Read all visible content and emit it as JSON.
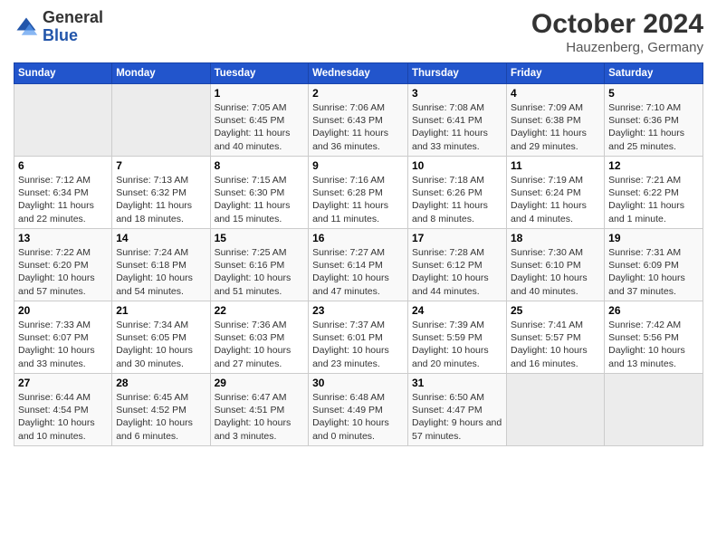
{
  "header": {
    "logo": {
      "general": "General",
      "blue": "Blue"
    },
    "title": "October 2024",
    "location": "Hauzenberg, Germany"
  },
  "calendar": {
    "weekdays": [
      "Sunday",
      "Monday",
      "Tuesday",
      "Wednesday",
      "Thursday",
      "Friday",
      "Saturday"
    ],
    "weeks": [
      [
        {
          "day": "",
          "info": ""
        },
        {
          "day": "",
          "info": ""
        },
        {
          "day": "1",
          "info": "Sunrise: 7:05 AM\nSunset: 6:45 PM\nDaylight: 11 hours and 40 minutes."
        },
        {
          "day": "2",
          "info": "Sunrise: 7:06 AM\nSunset: 6:43 PM\nDaylight: 11 hours and 36 minutes."
        },
        {
          "day": "3",
          "info": "Sunrise: 7:08 AM\nSunset: 6:41 PM\nDaylight: 11 hours and 33 minutes."
        },
        {
          "day": "4",
          "info": "Sunrise: 7:09 AM\nSunset: 6:38 PM\nDaylight: 11 hours and 29 minutes."
        },
        {
          "day": "5",
          "info": "Sunrise: 7:10 AM\nSunset: 6:36 PM\nDaylight: 11 hours and 25 minutes."
        }
      ],
      [
        {
          "day": "6",
          "info": "Sunrise: 7:12 AM\nSunset: 6:34 PM\nDaylight: 11 hours and 22 minutes."
        },
        {
          "day": "7",
          "info": "Sunrise: 7:13 AM\nSunset: 6:32 PM\nDaylight: 11 hours and 18 minutes."
        },
        {
          "day": "8",
          "info": "Sunrise: 7:15 AM\nSunset: 6:30 PM\nDaylight: 11 hours and 15 minutes."
        },
        {
          "day": "9",
          "info": "Sunrise: 7:16 AM\nSunset: 6:28 PM\nDaylight: 11 hours and 11 minutes."
        },
        {
          "day": "10",
          "info": "Sunrise: 7:18 AM\nSunset: 6:26 PM\nDaylight: 11 hours and 8 minutes."
        },
        {
          "day": "11",
          "info": "Sunrise: 7:19 AM\nSunset: 6:24 PM\nDaylight: 11 hours and 4 minutes."
        },
        {
          "day": "12",
          "info": "Sunrise: 7:21 AM\nSunset: 6:22 PM\nDaylight: 11 hours and 1 minute."
        }
      ],
      [
        {
          "day": "13",
          "info": "Sunrise: 7:22 AM\nSunset: 6:20 PM\nDaylight: 10 hours and 57 minutes."
        },
        {
          "day": "14",
          "info": "Sunrise: 7:24 AM\nSunset: 6:18 PM\nDaylight: 10 hours and 54 minutes."
        },
        {
          "day": "15",
          "info": "Sunrise: 7:25 AM\nSunset: 6:16 PM\nDaylight: 10 hours and 51 minutes."
        },
        {
          "day": "16",
          "info": "Sunrise: 7:27 AM\nSunset: 6:14 PM\nDaylight: 10 hours and 47 minutes."
        },
        {
          "day": "17",
          "info": "Sunrise: 7:28 AM\nSunset: 6:12 PM\nDaylight: 10 hours and 44 minutes."
        },
        {
          "day": "18",
          "info": "Sunrise: 7:30 AM\nSunset: 6:10 PM\nDaylight: 10 hours and 40 minutes."
        },
        {
          "day": "19",
          "info": "Sunrise: 7:31 AM\nSunset: 6:09 PM\nDaylight: 10 hours and 37 minutes."
        }
      ],
      [
        {
          "day": "20",
          "info": "Sunrise: 7:33 AM\nSunset: 6:07 PM\nDaylight: 10 hours and 33 minutes."
        },
        {
          "day": "21",
          "info": "Sunrise: 7:34 AM\nSunset: 6:05 PM\nDaylight: 10 hours and 30 minutes."
        },
        {
          "day": "22",
          "info": "Sunrise: 7:36 AM\nSunset: 6:03 PM\nDaylight: 10 hours and 27 minutes."
        },
        {
          "day": "23",
          "info": "Sunrise: 7:37 AM\nSunset: 6:01 PM\nDaylight: 10 hours and 23 minutes."
        },
        {
          "day": "24",
          "info": "Sunrise: 7:39 AM\nSunset: 5:59 PM\nDaylight: 10 hours and 20 minutes."
        },
        {
          "day": "25",
          "info": "Sunrise: 7:41 AM\nSunset: 5:57 PM\nDaylight: 10 hours and 16 minutes."
        },
        {
          "day": "26",
          "info": "Sunrise: 7:42 AM\nSunset: 5:56 PM\nDaylight: 10 hours and 13 minutes."
        }
      ],
      [
        {
          "day": "27",
          "info": "Sunrise: 6:44 AM\nSunset: 4:54 PM\nDaylight: 10 hours and 10 minutes."
        },
        {
          "day": "28",
          "info": "Sunrise: 6:45 AM\nSunset: 4:52 PM\nDaylight: 10 hours and 6 minutes."
        },
        {
          "day": "29",
          "info": "Sunrise: 6:47 AM\nSunset: 4:51 PM\nDaylight: 10 hours and 3 minutes."
        },
        {
          "day": "30",
          "info": "Sunrise: 6:48 AM\nSunset: 4:49 PM\nDaylight: 10 hours and 0 minutes."
        },
        {
          "day": "31",
          "info": "Sunrise: 6:50 AM\nSunset: 4:47 PM\nDaylight: 9 hours and 57 minutes."
        },
        {
          "day": "",
          "info": ""
        },
        {
          "day": "",
          "info": ""
        }
      ]
    ]
  }
}
